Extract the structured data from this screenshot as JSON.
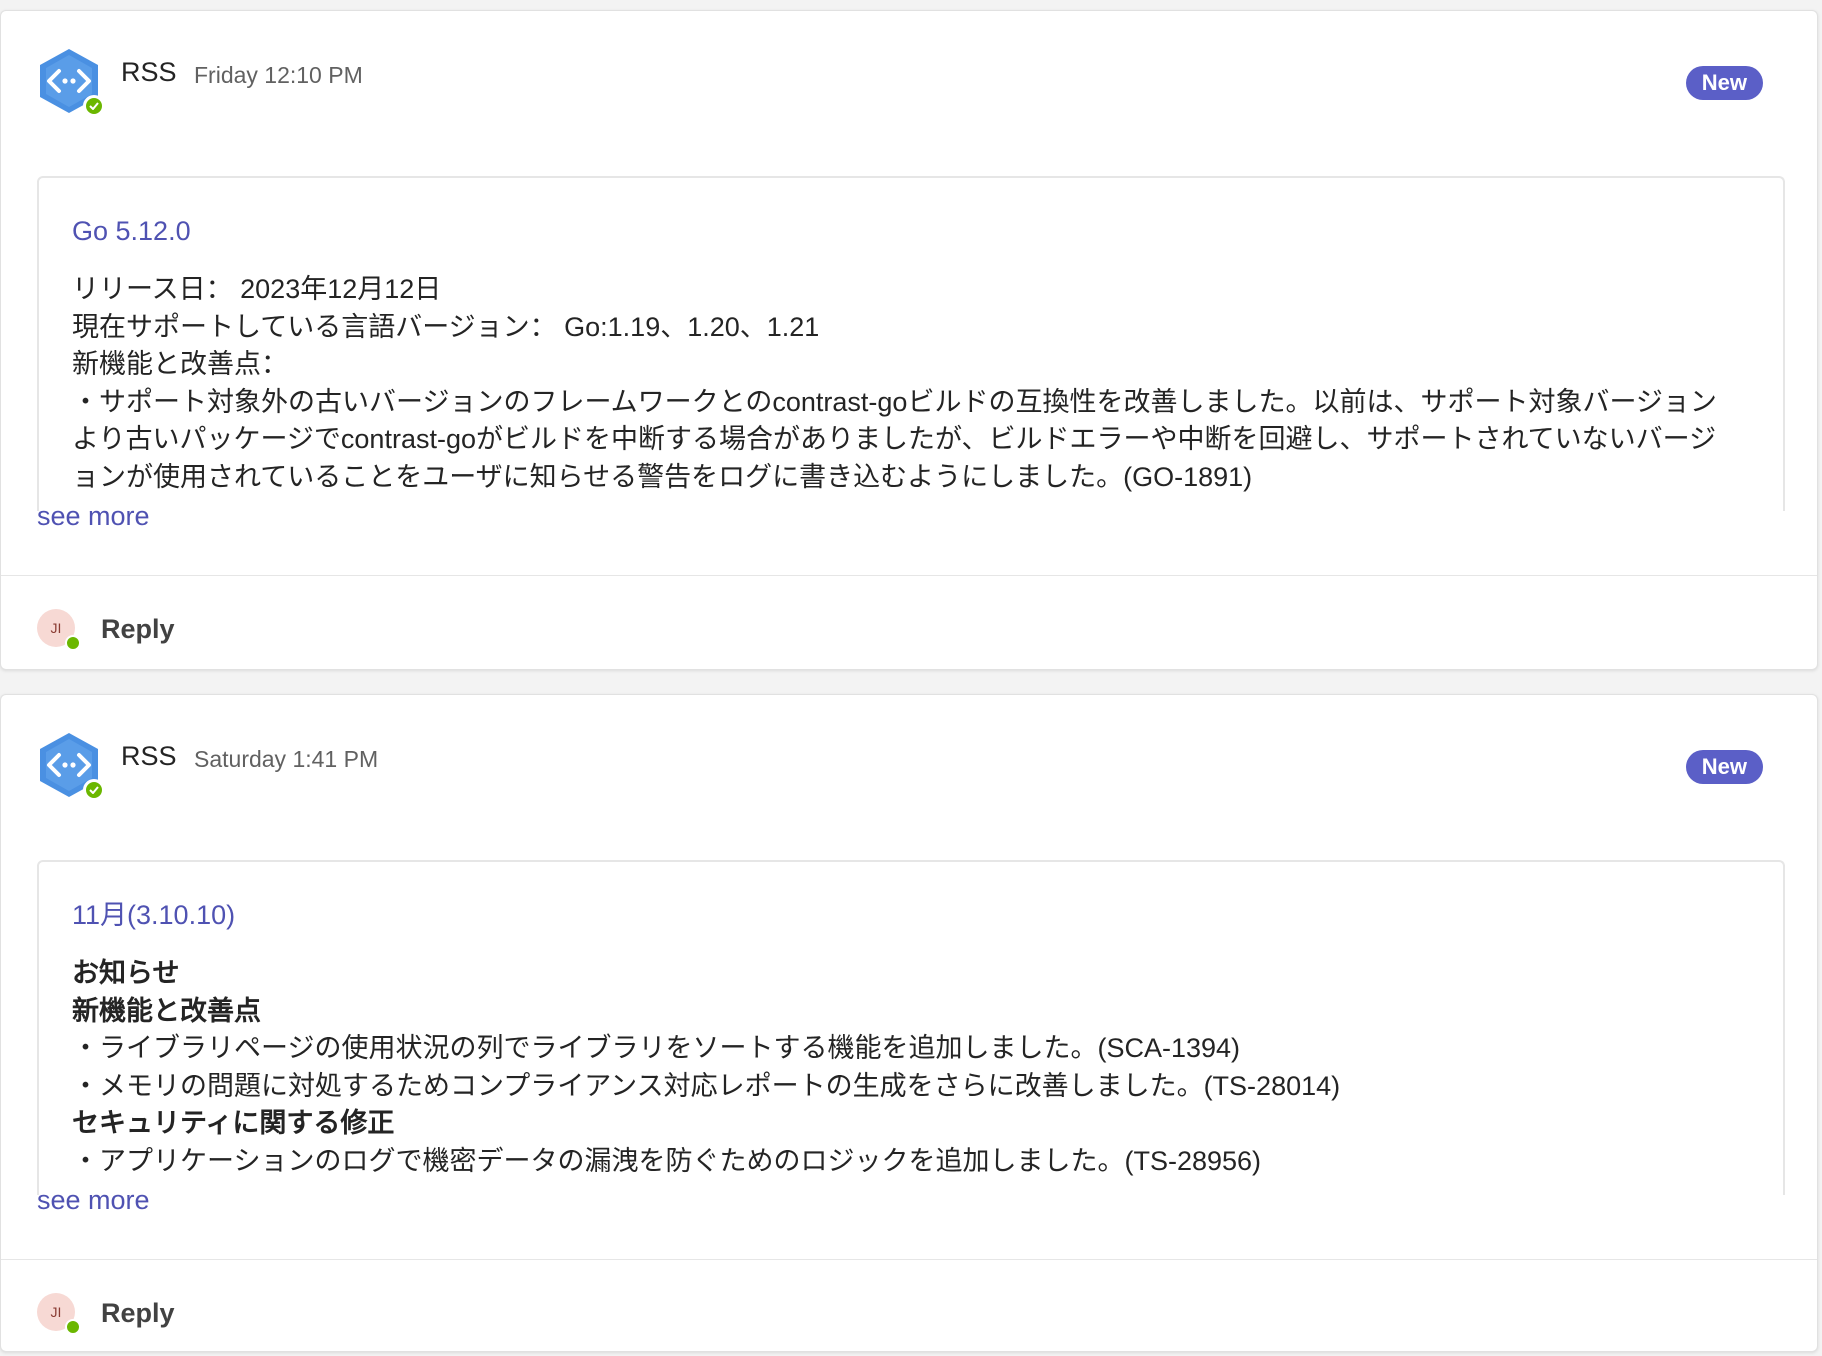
{
  "colors": {
    "accent": "#5b5fc7",
    "link": "#4f52b2",
    "presence": "#6bb700",
    "bot_icon": "#4a90e2"
  },
  "icons": {
    "bot_avatar": "rss-connector-icon",
    "presence": "presence-available-icon"
  },
  "posts": [
    {
      "author": "RSS",
      "timestamp": "Friday 12:10 PM",
      "badge": "New",
      "card": {
        "title": "Go 5.12.0",
        "lines": [
          "リリース日： 2023年12月12日",
          "現在サポートしている言語バージョン： Go:1.19、1.20、1.21",
          "新機能と改善点：",
          "・サポート対象外の古いバージョンのフレームワークとのcontrast-goビルドの互換性を改善しました。以前は、サポート対象バージョンより古いパッケージでcontrast-goがビルドを中断する場合がありましたが、ビルドエラーや中断を回避し、サポートされていないバージョンが使用されていることをユーザに知らせる警告をログに書き込むようにしました。(GO-1891)"
        ]
      },
      "see_more": "see more",
      "reply": {
        "avatar_initials": "JI",
        "label": "Reply"
      }
    },
    {
      "author": "RSS",
      "timestamp": "Saturday 1:41 PM",
      "badge": "New",
      "card": {
        "title": "11月(3.10.10)",
        "heading_1": "お知らせ",
        "heading_2": "新機能と改善点",
        "lines_1": [
          "・ライブラリページの使用状況の列でライブラリをソートする機能を追加しました。(SCA-1394)",
          "・メモリの問題に対処するためコンプライアンス対応レポートの生成をさらに改善しました。(TS-28014)"
        ],
        "heading_3": "セキュリティに関する修正",
        "lines_2": [
          "・アプリケーションのログで機密データの漏洩を防ぐためのロジックを追加しました。(TS-28956)"
        ]
      },
      "see_more": "see more",
      "reply": {
        "avatar_initials": "JI",
        "label": "Reply"
      }
    }
  ]
}
